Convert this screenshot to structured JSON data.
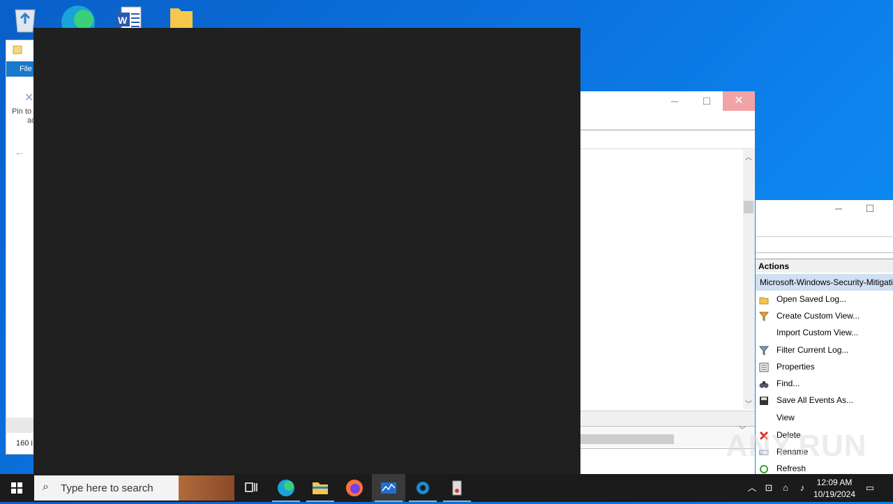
{
  "explorer": {
    "file_tab": "File",
    "pin_label_line1": "Pin to",
    "pin_label_line2": "acc",
    "status": "160 i"
  },
  "actions_pane": {
    "title": "Actions",
    "selected_log": "Microsoft-Windows-Security-Mitigations",
    "items": [
      {
        "label": "Open Saved Log...",
        "icon": "folder-open-icon"
      },
      {
        "label": "Create Custom View...",
        "icon": "filter-icon"
      },
      {
        "label": "Import Custom View...",
        "icon": ""
      },
      {
        "label": "Filter Current Log...",
        "icon": "filter-icon"
      },
      {
        "label": "Properties",
        "icon": "properties-icon"
      },
      {
        "label": "Find...",
        "icon": "binoculars-icon"
      },
      {
        "label": "Save All Events As...",
        "icon": "save-icon"
      },
      {
        "label": "View",
        "icon": ""
      },
      {
        "label": "Delete",
        "icon": "delete-icon"
      },
      {
        "label": "Rename",
        "icon": "rename-icon"
      },
      {
        "label": "Refresh",
        "icon": "refresh-icon"
      }
    ]
  },
  "taskbar": {
    "search_placeholder": "Type here to search",
    "time": "12:09 AM",
    "date": "10/19/2024"
  },
  "watermark": "ANY.RUN",
  "colors": {
    "desktop": "#0b74e0",
    "taskbar": "#1b1b1b",
    "selected": "#cfe0f2",
    "close_hover": "#f1a3a6"
  }
}
